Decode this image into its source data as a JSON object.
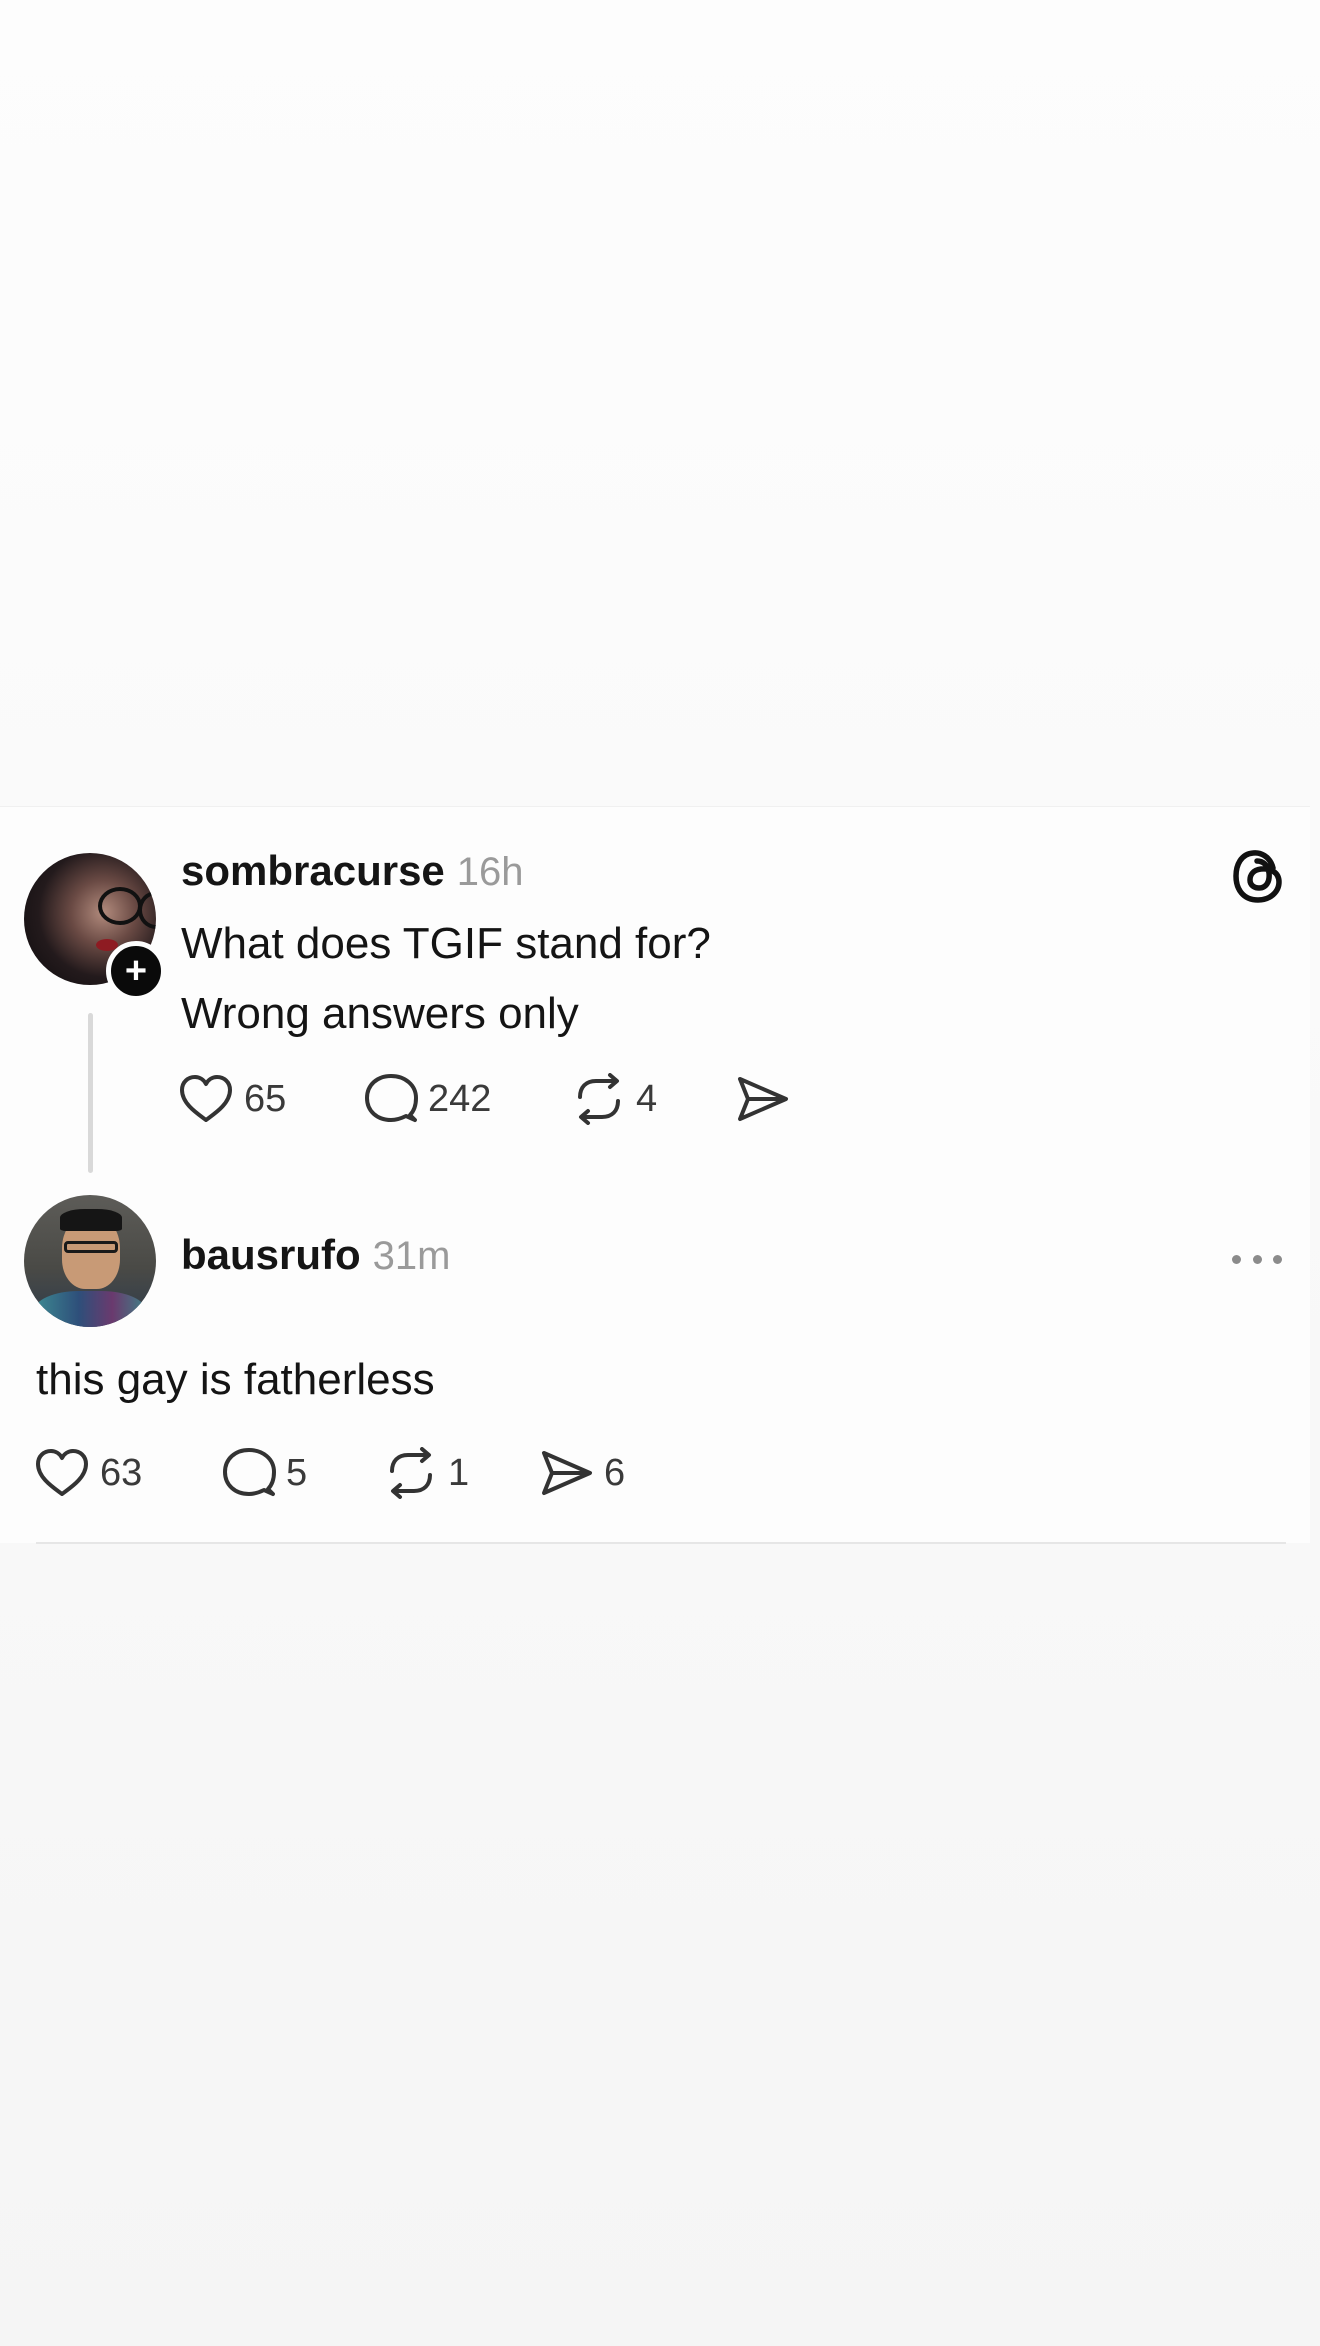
{
  "parent_post": {
    "username": "sombracurse",
    "time": "16h",
    "text_line1": "What does TGIF stand for?",
    "text_line2": "Wrong answers only",
    "follow_badge": "+",
    "likes": "65",
    "replies": "242",
    "reposts": "4",
    "icons": [
      "heart-icon",
      "comment-icon",
      "repost-icon",
      "share-icon",
      "threads-logo-icon"
    ]
  },
  "reply_post": {
    "username": "bausrufo",
    "time": "31m",
    "text": "this gay is fatherless",
    "likes": "63",
    "replies": "5",
    "reposts": "1",
    "shares": "6",
    "icons": [
      "heart-icon",
      "comment-icon",
      "repost-icon",
      "share-icon",
      "more-options-icon"
    ]
  },
  "colors": {
    "background": "#fdfdfd",
    "text": "#141414",
    "muted": "#9a9a9a",
    "thread_line": "#d9d9d9"
  }
}
